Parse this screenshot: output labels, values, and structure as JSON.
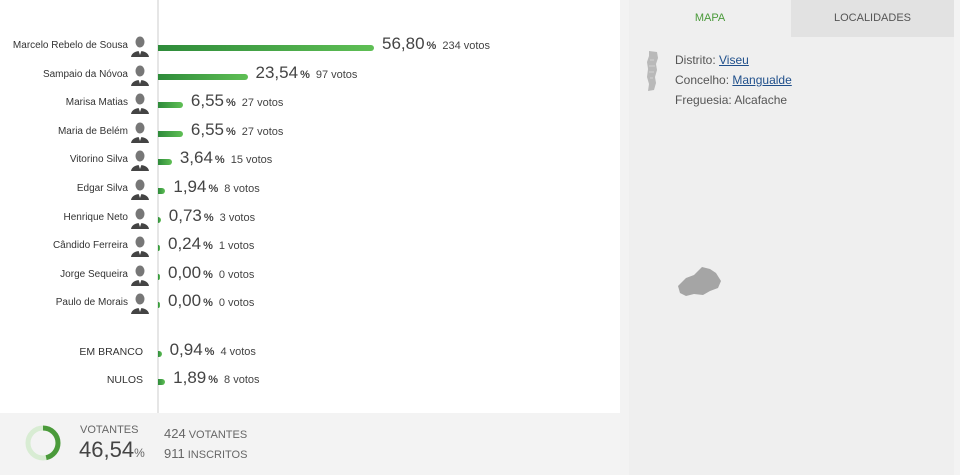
{
  "candidates": [
    {
      "name": "Marcelo Rebelo de Sousa",
      "pct": "56,80",
      "votes": "234 votos",
      "share": 0.568
    },
    {
      "name": "Sampaio da Nóvoa",
      "pct": "23,54",
      "votes": "97 votos",
      "share": 0.2354
    },
    {
      "name": "Marisa Matias",
      "pct": "6,55",
      "votes": "27 votos",
      "share": 0.0655
    },
    {
      "name": "Maria de Belém",
      "pct": "6,55",
      "votes": "27 votos",
      "share": 0.0655
    },
    {
      "name": "Vitorino Silva",
      "pct": "3,64",
      "votes": "15 votos",
      "share": 0.0364
    },
    {
      "name": "Edgar Silva",
      "pct": "1,94",
      "votes": "8 votos",
      "share": 0.0194
    },
    {
      "name": "Henrique Neto",
      "pct": "0,73",
      "votes": "3 votos",
      "share": 0.0073
    },
    {
      "name": "Cândido Ferreira",
      "pct": "0,24",
      "votes": "1 votos",
      "share": 0.0024
    },
    {
      "name": "Jorge Sequeira",
      "pct": "0,00",
      "votes": "0 votos",
      "share": 0
    },
    {
      "name": "Paulo de Morais",
      "pct": "0,00",
      "votes": "0 votos",
      "share": 0
    }
  ],
  "blank": {
    "name": "EM BRANCO",
    "pct": "0,94",
    "votes": "4 votos",
    "share": 0.0094
  },
  "null": {
    "name": "NULOS",
    "pct": "1,89",
    "votes": "8 votos",
    "share": 0.0189
  },
  "percent_symbol": "%",
  "turnout": {
    "label": "VOTANTES",
    "pct": "46,54",
    "share": 0.4654,
    "voters": "424",
    "voters_label": "VOTANTES",
    "registered": "911",
    "registered_label": "INSCRITOS"
  },
  "tabs": {
    "map": "MAPA",
    "places": "LOCALIDADES"
  },
  "location": {
    "district_label": "Distrito:",
    "district": "Viseu",
    "municipality_label": "Concelho:",
    "municipality": "Mangualde",
    "parish_label": "Freguesia:",
    "parish": "Alcafache"
  },
  "colors": {
    "accent": "#4a9a3a",
    "bar_start": "#2e8b3a",
    "bar_end": "#5fbf55",
    "link": "#1f4f8b"
  }
}
